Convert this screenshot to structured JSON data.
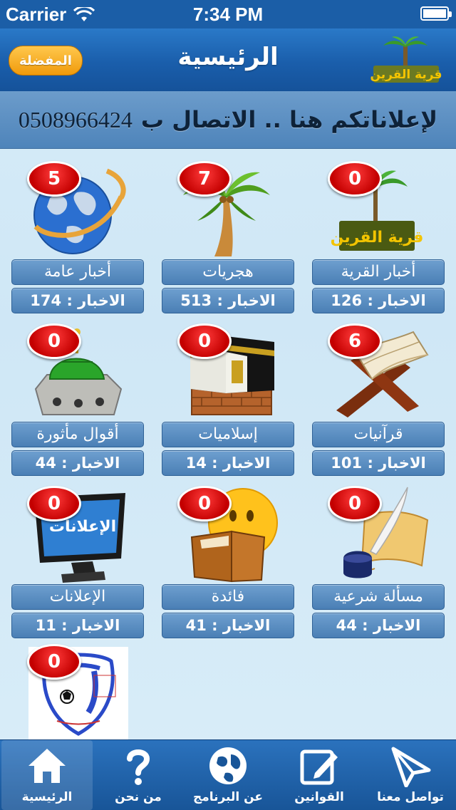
{
  "status_bar": {
    "carrier": "Carrier",
    "time": "7:34 PM"
  },
  "header": {
    "title": "الرئيسية",
    "favorites_button": "المفضلة",
    "logo_text": "قرية القرين"
  },
  "ad_banner": {
    "text": "لإعلاناتكم هنا .. الاتصال ب",
    "phone": "0508966424"
  },
  "categories": [
    {
      "label": "أخبار عامة",
      "count": "الاخبار : 174",
      "badge": "5",
      "icon": "globe-icon"
    },
    {
      "label": "هجريات",
      "count": "الاخبار : 513",
      "badge": "7",
      "icon": "palm-tree-icon"
    },
    {
      "label": "أخبار القرية",
      "count": "الاخبار : 126",
      "badge": "0",
      "icon": "village-logo-icon"
    },
    {
      "label": "أقوال مأثورة",
      "count": "الاخبار : 44",
      "badge": "0",
      "icon": "green-dome-icon"
    },
    {
      "label": "إسلاميات",
      "count": "الاخبار : 14",
      "badge": "0",
      "icon": "kaaba-icon"
    },
    {
      "label": "قرآنيات",
      "count": "الاخبار : 101",
      "badge": "6",
      "icon": "quran-stand-icon"
    },
    {
      "label": "الإعلانات",
      "count": "الاخبار : 11",
      "badge": "0",
      "icon": "monitor-icon",
      "screen_text": "الإعلانات"
    },
    {
      "label": "فائدة",
      "count": "الاخبار : 41",
      "badge": "0",
      "icon": "reading-smiley-icon"
    },
    {
      "label": "مسألة شرعية",
      "count": "الاخبار : 44",
      "badge": "0",
      "icon": "quill-scroll-icon"
    },
    {
      "badge": "0",
      "icon": "club-logo-icon"
    }
  ],
  "tabs": [
    {
      "label": "الرئيسية",
      "icon": "home-icon",
      "active": true
    },
    {
      "label": "من نحن",
      "icon": "question-icon"
    },
    {
      "label": "عن البرنامج",
      "icon": "globe-icon"
    },
    {
      "label": "القوانين",
      "icon": "edit-icon"
    },
    {
      "label": "تواصل معنا",
      "icon": "send-icon"
    }
  ],
  "colors": {
    "nav_blue": "#1a5eab",
    "badge_red": "#d40000",
    "fav_orange": "#f5a623"
  }
}
